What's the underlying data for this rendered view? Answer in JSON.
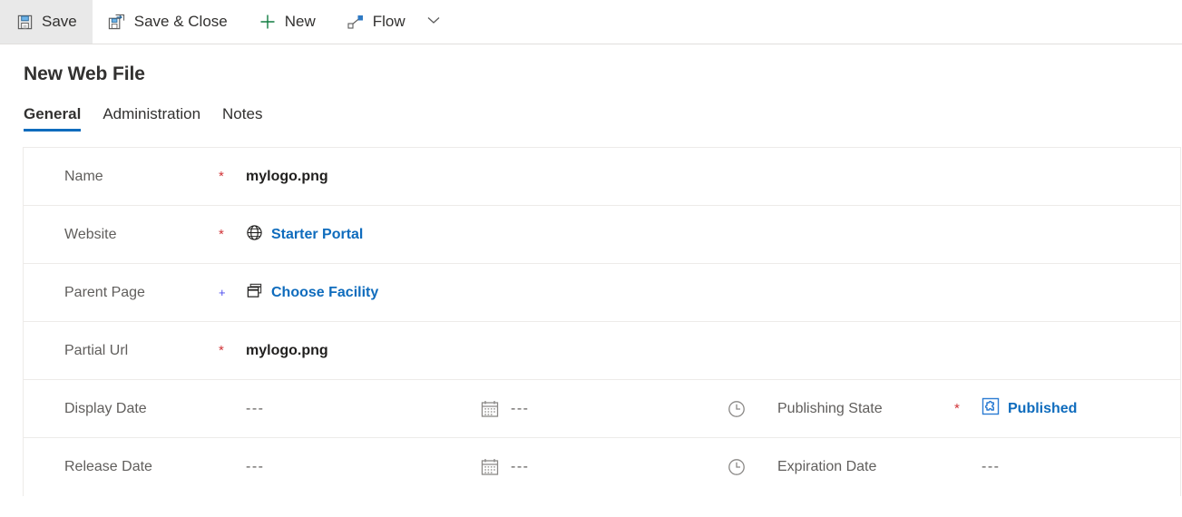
{
  "commandbar": {
    "buttons": [
      {
        "label": "Save",
        "icon": "save-icon",
        "active": true
      },
      {
        "label": "Save & Close",
        "icon": "save-and-close-icon",
        "active": false
      },
      {
        "label": "New",
        "icon": "plus-icon",
        "active": false
      },
      {
        "label": "Flow",
        "icon": "flow-icon",
        "active": false
      }
    ],
    "overflow_icon": "chevron-down-icon"
  },
  "header": {
    "title": "New Web File"
  },
  "tabs": [
    {
      "label": "General",
      "selected": true
    },
    {
      "label": "Administration",
      "selected": false
    },
    {
      "label": "Notes",
      "selected": false
    }
  ],
  "form": {
    "rows": [
      {
        "label": "Name",
        "requirement": "required",
        "requirement_glyph": "*",
        "value": "mylogo.png",
        "value_kind": "text"
      },
      {
        "label": "Website",
        "requirement": "required",
        "requirement_glyph": "*",
        "value": "Starter Portal",
        "value_kind": "lookup",
        "icon": "globe-icon"
      },
      {
        "label": "Parent Page",
        "requirement": "recommended",
        "requirement_glyph": "+",
        "value": "Choose Facility",
        "value_kind": "lookup",
        "icon": "pages-icon"
      },
      {
        "label": "Partial Url",
        "requirement": "required",
        "requirement_glyph": "*",
        "value": "mylogo.png",
        "value_kind": "text"
      }
    ],
    "datetime_rows": [
      {
        "label": "Display Date",
        "date_value": "---",
        "date_icon": "calendar-icon",
        "time_value": "---",
        "time_icon": "clock-icon",
        "right_label": "Publishing State",
        "right_requirement": "required",
        "right_requirement_glyph": "*",
        "right_value": "Published",
        "right_value_kind": "lookup",
        "right_icon": "publishing-state-icon"
      },
      {
        "label": "Release Date",
        "date_value": "---",
        "date_icon": "calendar-icon",
        "time_value": "---",
        "time_icon": "clock-icon",
        "right_label": "Expiration Date",
        "right_requirement": "none",
        "right_requirement_glyph": "",
        "right_value": "---",
        "right_value_kind": "muted",
        "right_icon": ""
      }
    ]
  },
  "colors": {
    "accent": "#0f6cbd",
    "required": "#d13438",
    "recommended": "#4a4aef",
    "new_plus": "#107c41"
  }
}
